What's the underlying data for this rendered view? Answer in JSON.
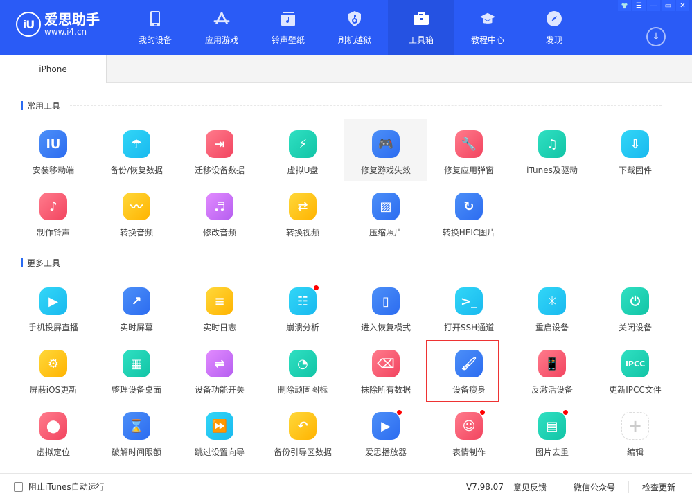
{
  "app": {
    "logo_mark": "iU",
    "name": "爱思助手",
    "url": "www.i4.cn",
    "brand_color": "#2a5bf6"
  },
  "nav": [
    {
      "label": "我的设备",
      "icon": "phone-icon"
    },
    {
      "label": "应用游戏",
      "icon": "app-store-icon"
    },
    {
      "label": "铃声壁纸",
      "icon": "music-folder-icon"
    },
    {
      "label": "刷机越狱",
      "icon": "shield-key-icon"
    },
    {
      "label": "工具箱",
      "icon": "toolbox-icon",
      "active": true
    },
    {
      "label": "教程中心",
      "icon": "graduation-cap-icon"
    },
    {
      "label": "发现",
      "icon": "compass-icon"
    }
  ],
  "window_controls": {
    "skin": "👕",
    "menu": "☰",
    "minimize": "—",
    "maximize": "▭",
    "close": "✕"
  },
  "download_glyph": "↓",
  "tabs": [
    {
      "label": "iPhone",
      "active": true
    }
  ],
  "sections": {
    "common": {
      "title": "常用工具",
      "tools": [
        {
          "label": "安装移动端",
          "icon": "iu-logo-icon",
          "color": "blue",
          "glyph": "iU"
        },
        {
          "label": "备份/恢复数据",
          "icon": "umbrella-icon",
          "color": "cyan",
          "glyph": "☂"
        },
        {
          "label": "迁移设备数据",
          "icon": "migrate-icon",
          "color": "red",
          "glyph": "⇥"
        },
        {
          "label": "虚拟U盘",
          "icon": "usb-drive-icon",
          "color": "green",
          "glyph": "⚡"
        },
        {
          "label": "修复游戏失效",
          "icon": "gamepad-icon",
          "color": "blue",
          "glyph": "🎮",
          "hover": true
        },
        {
          "label": "修复应用弹窗",
          "icon": "window-wrench-icon",
          "color": "red",
          "glyph": "🔧"
        },
        {
          "label": "iTunes及驱动",
          "icon": "music-gear-icon",
          "color": "green",
          "glyph": "♫"
        },
        {
          "label": "下载固件",
          "icon": "download-tray-icon",
          "color": "cyan",
          "glyph": "⇩"
        },
        {
          "label": "制作铃声",
          "icon": "music-note-plus-icon",
          "color": "red",
          "glyph": "♪"
        },
        {
          "label": "转换音频",
          "icon": "waveform-icon",
          "color": "yellow",
          "glyph": "〰"
        },
        {
          "label": "修改音频",
          "icon": "audio-file-gear-icon",
          "color": "purple",
          "glyph": "♬"
        },
        {
          "label": "转换视频",
          "icon": "video-camera-icon",
          "color": "yellow",
          "glyph": "⇄"
        },
        {
          "label": "压缩照片",
          "icon": "image-icon",
          "color": "blue",
          "glyph": "▨"
        },
        {
          "label": "转换HEIC图片",
          "icon": "image-convert-icon",
          "color": "blue",
          "glyph": "↻"
        }
      ]
    },
    "more": {
      "title": "更多工具",
      "tools": [
        {
          "label": "手机投屏直播",
          "icon": "phone-play-icon",
          "color": "cyan",
          "glyph": "▶"
        },
        {
          "label": "实时屏幕",
          "icon": "screen-mirror-icon",
          "color": "blue",
          "glyph": "↗"
        },
        {
          "label": "实时日志",
          "icon": "document-icon",
          "color": "yellow",
          "glyph": "≡"
        },
        {
          "label": "崩溃分析",
          "icon": "clipboard-list-icon",
          "color": "cyan",
          "glyph": "☷",
          "badge": true
        },
        {
          "label": "进入恢复模式",
          "icon": "tablet-cable-icon",
          "color": "blue",
          "glyph": "▯"
        },
        {
          "label": "打开SSH通道",
          "icon": "terminal-icon",
          "color": "cyan",
          "glyph": ">_"
        },
        {
          "label": "重启设备",
          "icon": "loading-spinner-icon",
          "color": "cyan",
          "glyph": "✳"
        },
        {
          "label": "关闭设备",
          "icon": "power-icon",
          "color": "green",
          "glyph": "⏻"
        },
        {
          "label": "屏蔽iOS更新",
          "icon": "gear-slash-icon",
          "color": "yellow",
          "glyph": "⚙"
        },
        {
          "label": "整理设备桌面",
          "icon": "grid-icon",
          "color": "green",
          "glyph": "▦"
        },
        {
          "label": "设备功能开关",
          "icon": "toggle-icon",
          "color": "purple",
          "glyph": "⇌"
        },
        {
          "label": "删除顽固图标",
          "icon": "pie-chart-icon",
          "color": "green",
          "glyph": "◔"
        },
        {
          "label": "抹除所有数据",
          "icon": "eraser-icon",
          "color": "red",
          "glyph": "⌫"
        },
        {
          "label": "设备瘦身",
          "icon": "brush-icon",
          "color": "blue",
          "glyph": "🖌",
          "selected": true
        },
        {
          "label": "反激活设备",
          "icon": "phone-lock-icon",
          "color": "red",
          "glyph": "📱"
        },
        {
          "label": "更新IPCC文件",
          "icon": "ipcc-icon",
          "color": "green",
          "glyph": "IPCC"
        },
        {
          "label": "虚拟定位",
          "icon": "location-pin-icon",
          "color": "red",
          "glyph": "⬤"
        },
        {
          "label": "破解时间限额",
          "icon": "hourglass-icon",
          "color": "blue",
          "glyph": "⌛"
        },
        {
          "label": "跳过设置向导",
          "icon": "skip-setup-icon",
          "color": "cyan",
          "glyph": "⏩"
        },
        {
          "label": "备份引导区数据",
          "icon": "disk-backup-icon",
          "color": "yellow",
          "glyph": "↶"
        },
        {
          "label": "爱思播放器",
          "icon": "play-circle-icon",
          "color": "blue",
          "glyph": "▶",
          "badge": true
        },
        {
          "label": "表情制作",
          "icon": "smiley-face-icon",
          "color": "red",
          "glyph": "☺",
          "badge": true
        },
        {
          "label": "图片去重",
          "icon": "images-stack-icon",
          "color": "green",
          "glyph": "▤",
          "badge": true
        },
        {
          "label": "编辑",
          "icon": "plus-icon",
          "color": "edit",
          "glyph": "+"
        }
      ]
    }
  },
  "footer": {
    "checkbox_label": "阻止iTunes自动运行",
    "checkbox_checked": false,
    "version": "V7.98.07",
    "feedback": "意见反馈",
    "wechat": "微信公众号",
    "check_update": "检查更新"
  }
}
